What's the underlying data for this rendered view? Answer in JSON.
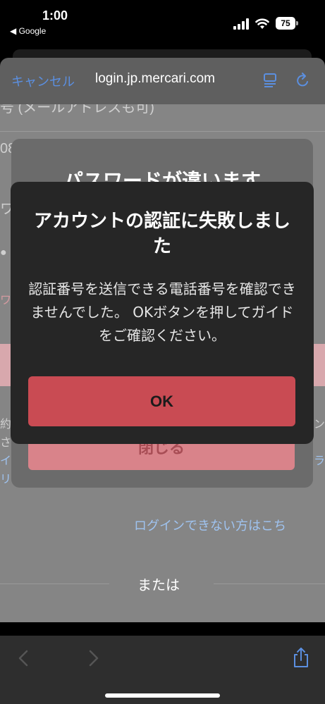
{
  "status": {
    "time": "1:00",
    "back_app": "◀ Google",
    "battery": "75"
  },
  "browser": {
    "cancel_label": "キャンセル",
    "url": "login.jp.mercari.com"
  },
  "page_background": {
    "fragment_top": "号 (メールアドレスも可)",
    "fragment_left_1": "08",
    "fragment_left_2": "ワー",
    "fragment_left_3": "●",
    "fragment_left_4": "ワ",
    "fragment_left_5": "約",
    "fragment_left_6": "さ",
    "fragment_left_7": "イ",
    "fragment_left_8": "リ",
    "fragment_right_1": "ン",
    "fragment_right_2": "ラ",
    "forgot_login_link": "ログインできない方はこち",
    "or_text": "または"
  },
  "password_modal": {
    "title": "パスワードが違います",
    "close_label": "閉じる"
  },
  "alert": {
    "title": "アカウントの認証に失敗しました",
    "message": "認証番号を送信できる電話番号を確認できませんでした。 OKボタンを押してガイドをご確認ください。",
    "ok_label": "OK"
  },
  "colors": {
    "accent_blue": "#5b8fe0",
    "ok_red": "#c94b53",
    "alert_bg": "#262626"
  },
  "icons": [
    "signal-icon",
    "wifi-icon",
    "battery-icon",
    "reader-icon",
    "reload-icon",
    "back-icon",
    "forward-icon",
    "share-icon"
  ]
}
